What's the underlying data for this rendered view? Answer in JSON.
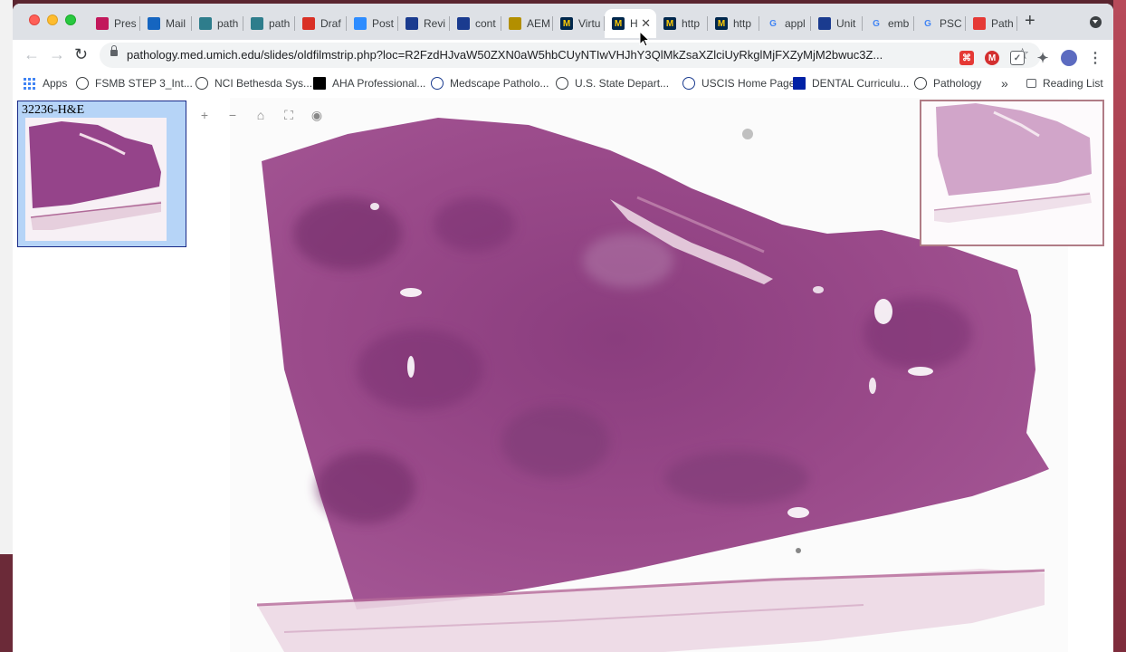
{
  "browser": {
    "tabs": [
      {
        "label": "Pres",
        "icon": "presentation-icon",
        "color": "#c2185b"
      },
      {
        "label": "Mail",
        "icon": "outlook-icon",
        "color": "#1565c0"
      },
      {
        "label": "path",
        "icon": "pathpresenter-icon",
        "color": "#2e7d8c"
      },
      {
        "label": "path",
        "icon": "pathpresenter-icon",
        "color": "#2e7d8c"
      },
      {
        "label": "Draf",
        "icon": "gmail-icon",
        "color": "#d93025"
      },
      {
        "label": "Post",
        "icon": "zoom-icon",
        "color": "#2d8cff"
      },
      {
        "label": "Revi",
        "icon": "pubmed-icon",
        "color": "#1a3b8f"
      },
      {
        "label": "cont",
        "icon": "pubmed-icon",
        "color": "#1a3b8f"
      },
      {
        "label": "AEM",
        "icon": "folder-icon",
        "color": "#b38f00"
      },
      {
        "label": "Virtu",
        "icon": "umich-icon",
        "color": "#00274c"
      },
      {
        "label": "H",
        "icon": "umich-icon",
        "color": "#00274c",
        "active": true
      },
      {
        "label": "http",
        "icon": "umich-icon",
        "color": "#00274c"
      },
      {
        "label": "http",
        "icon": "umich-icon",
        "color": "#00274c"
      },
      {
        "label": "appl",
        "icon": "google-icon",
        "color": "#4285f4"
      },
      {
        "label": "Unit",
        "icon": "pubmed-icon",
        "color": "#1a3b8f"
      },
      {
        "label": "emb",
        "icon": "google-icon",
        "color": "#4285f4"
      },
      {
        "label": "PSC",
        "icon": "google-icon",
        "color": "#4285f4"
      },
      {
        "label": "Path",
        "icon": "pathology-gear-icon",
        "color": "#e53935"
      }
    ],
    "url": "pathology.med.umich.edu/slides/oldfilmstrip.php?loc=R2FzdHJvaW50ZXN0aW5hbCUyNTIwVHJhY3QlMkZsaXZlciUyRkglMjFXZyMjM2bwuc3Z...",
    "bookmarks": {
      "apps": "Apps",
      "items": [
        {
          "label": "FSMB STEP 3_Int...",
          "icon": "globe-icon"
        },
        {
          "label": "NCI Bethesda Sys...",
          "icon": "globe-icon"
        },
        {
          "label": "AHA Professional...",
          "icon": "aha-icon"
        },
        {
          "label": "Medscape Patholo...",
          "icon": "medscape-icon"
        },
        {
          "label": "U.S. State Depart...",
          "icon": "globe-icon"
        },
        {
          "label": "USCIS Home Page",
          "icon": "uscis-icon"
        },
        {
          "label": "DENTAL Curriculu...",
          "icon": "uf-icon"
        },
        {
          "label": "Pathology",
          "icon": "person-icon"
        }
      ],
      "overflow": "»",
      "reading_list": "Reading List"
    }
  },
  "viewer": {
    "slide_label": "32236-H&E",
    "tools": [
      {
        "name": "zoom-in",
        "glyph": "+"
      },
      {
        "name": "zoom-out",
        "glyph": "−"
      },
      {
        "name": "home",
        "glyph": "⌂"
      },
      {
        "name": "fullscreen",
        "glyph": "⛶"
      },
      {
        "name": "snapshot",
        "glyph": "◉"
      }
    ]
  }
}
